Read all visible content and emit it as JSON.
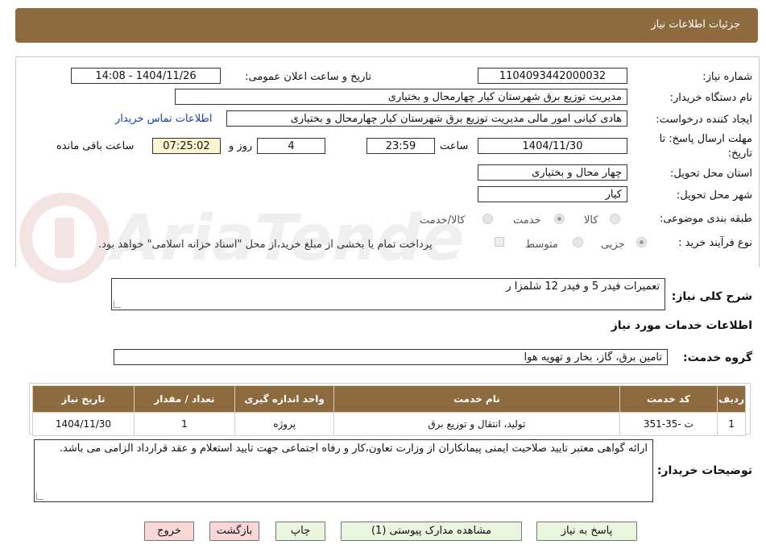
{
  "header": {
    "title": "جزئیات اطلاعات نیاز"
  },
  "fields": {
    "need_number_label": "شماره نیاز:",
    "need_number": "1104093442000032",
    "announce_label": "تاریخ و ساعت اعلان عمومی:",
    "announce_value": "1404/11/26 - 14:08",
    "buyer_label": "نام دستگاه خریدار:",
    "buyer_value": "مدیریت توزیع برق شهرستان کیار چهارمحال و بختیاری",
    "creator_label": "ایجاد کننده درخواست:",
    "creator_value": "هادی کیانی امور مالی مدیریت توزیع برق شهرستان کیار چهارمحال و بختیاری",
    "contact_link": "اطلاعات تماس خریدار",
    "deadline_label_1": "مهلت ارسال پاسخ: تا",
    "deadline_label_2": "تاریخ:",
    "deadline_date": "1404/11/30",
    "hour_label": "ساعت",
    "deadline_time": "23:59",
    "days_value": "4",
    "days_label": "روز و",
    "remaining_value": "07:25:02",
    "remaining_label": "ساعت باقی مانده",
    "province_label": "استان محل تحویل:",
    "province_value": "چهار محال و بختیاری",
    "city_label": "شهر محل تحویل:",
    "city_value": "کیار",
    "category_label": "طبقه بندی موضوعی:",
    "category_options": [
      "کالا",
      "خدمت",
      "کالا/خدمت"
    ],
    "process_label": "نوع فرآیند خرید :",
    "process_options": [
      "جزیی",
      "متوسط"
    ],
    "payment_note": "پرداخت تمام یا بخشی از مبلغ خرید،از محل \"اسناد خزانه اسلامی\" خواهد بود."
  },
  "summary": {
    "label": "شرح کلی نیاز:",
    "value": "تعمیرات فیدر 5 و فیدر 12 شلمزا ر"
  },
  "services": {
    "section_title": "اطلاعات خدمات مورد نیاز",
    "group_label": "گروه خدمت:",
    "group_value": "تامین برق، گاز، بخار و تهویه هوا",
    "columns": [
      "ردیف",
      "کد خدمت",
      "نام خدمت",
      "واحد اندازه گیری",
      "تعداد / مقدار",
      "تاریخ نیاز"
    ],
    "rows": [
      [
        "1",
        "ت -35-351",
        "تولید، انتقال و توزیع برق",
        "پروژه",
        "1",
        "1404/11/30"
      ]
    ]
  },
  "buyer_notes": {
    "label": "توضیحات خریدار:",
    "value": "ارائه گواهی معتبر تایید صلاحیت ایمنی پیمانکاران از وزارت تعاون،کار و رفاه اجتماعی جهت تایید استعلام و عقد قرارداد الزامی می باشد."
  },
  "buttons": {
    "reply": "پاسخ به نیاز",
    "attachments": "مشاهده مدارک پیوستی (1)",
    "print": "چاپ",
    "back": "بازگشت",
    "exit": "خروج"
  },
  "watermark": {
    "text": "AriaTender.neT"
  },
  "colors": {
    "header_bg": "#8e6a3f",
    "link": "#1a3fa8",
    "button_green": "#e9f6de",
    "button_pink": "#f9d7d7",
    "remaining_bg": "#fbf4cf"
  }
}
